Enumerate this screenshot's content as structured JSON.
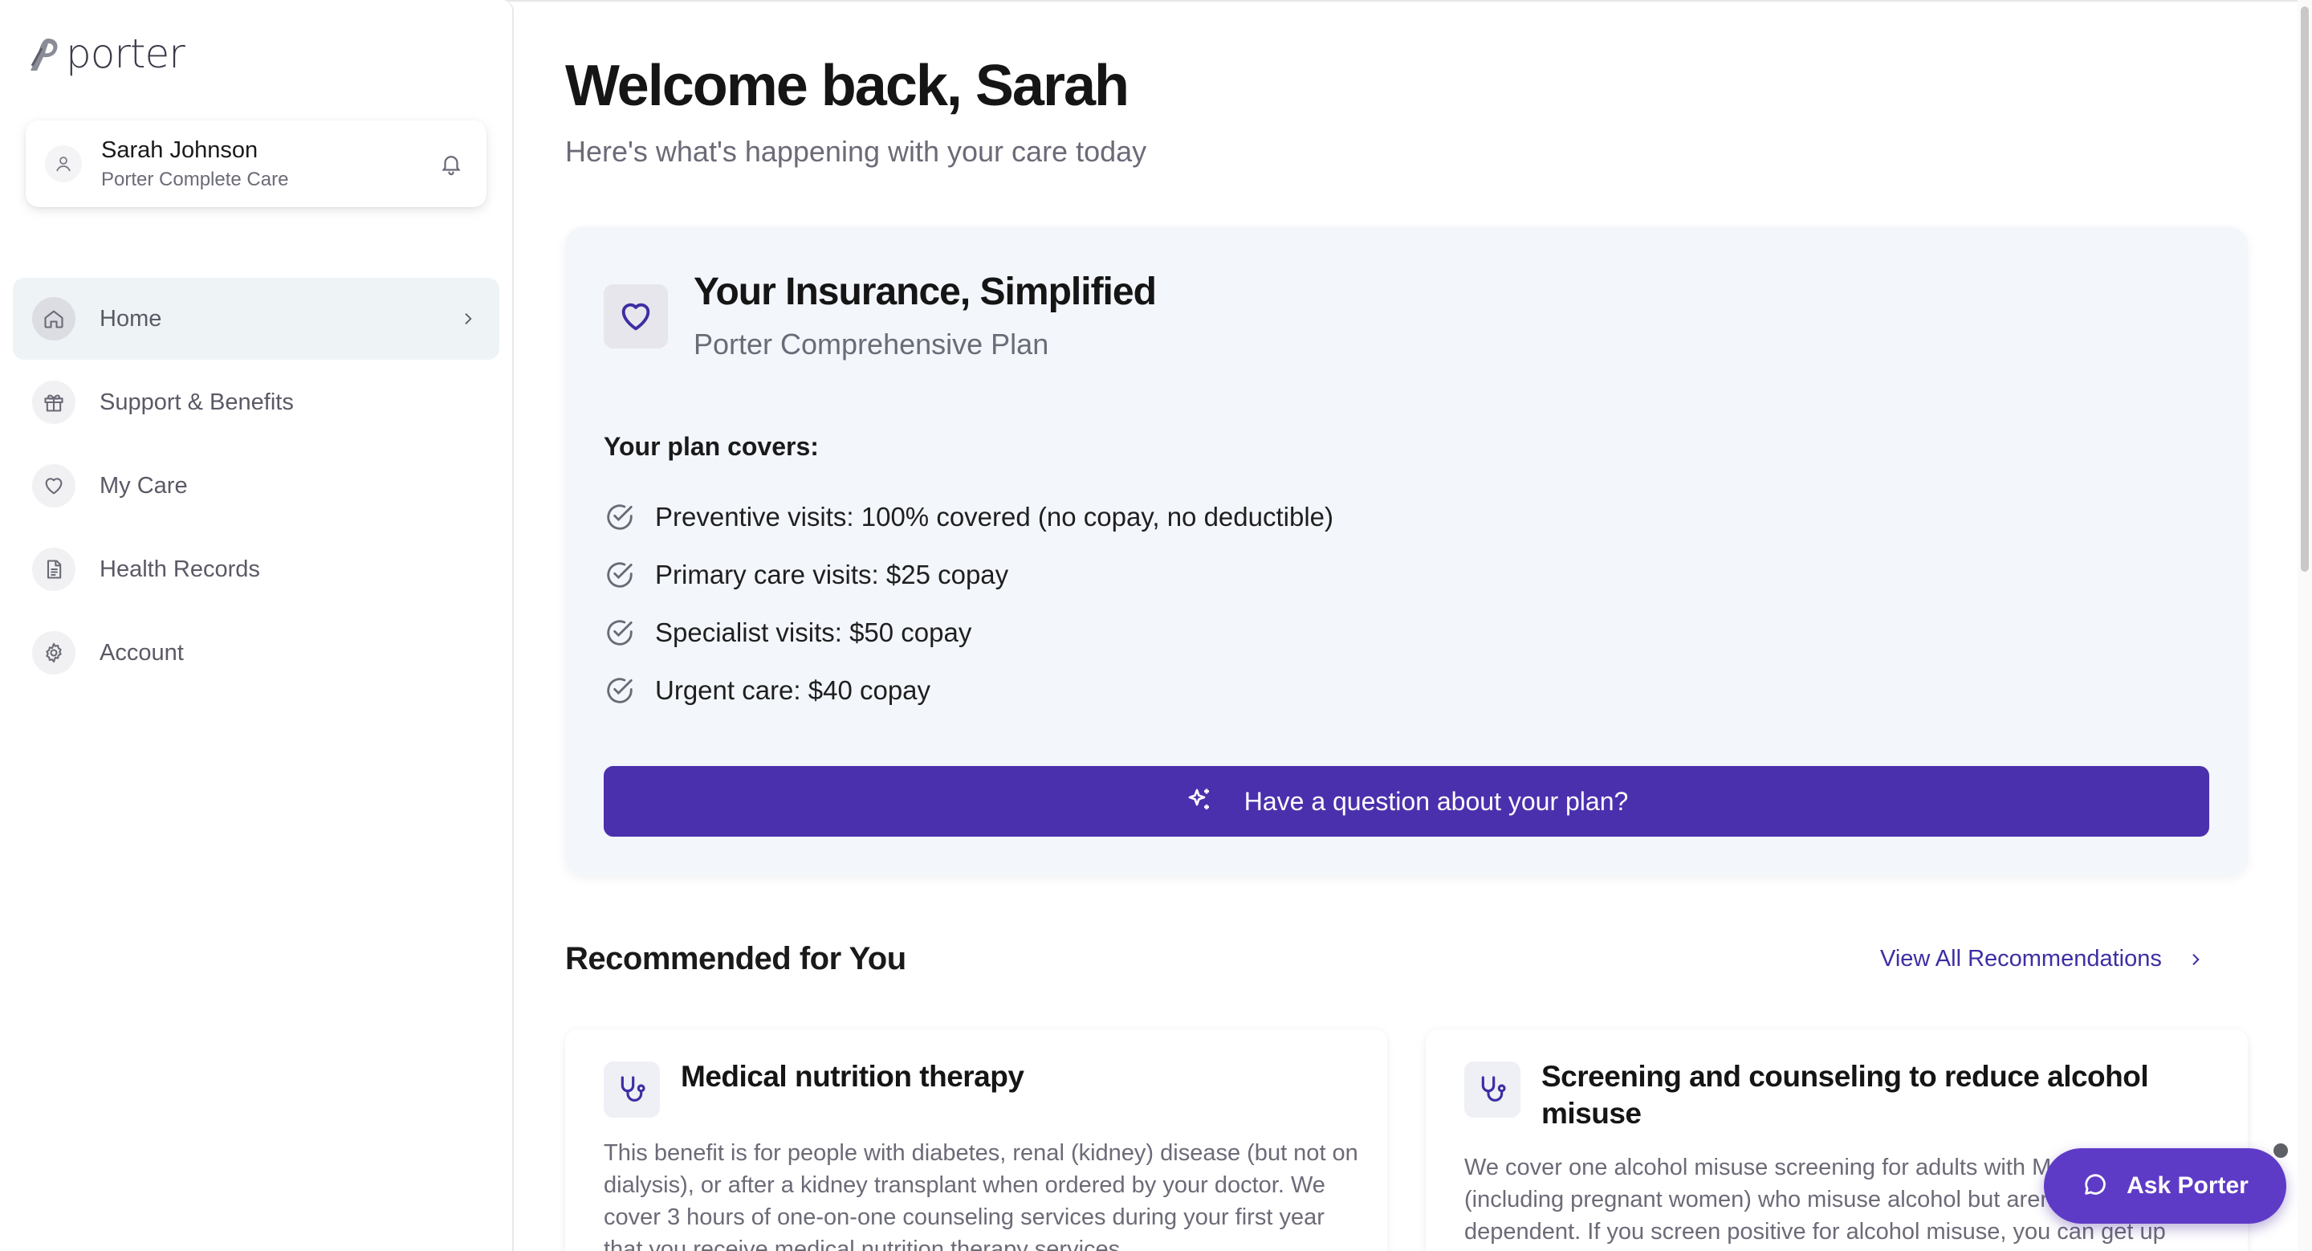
{
  "brand": {
    "logo_text": "porter",
    "accent": "#4b30ad"
  },
  "user": {
    "name": "Sarah Johnson",
    "plan": "Porter Complete Care"
  },
  "sidebar": {
    "items": [
      {
        "label": "Home",
        "icon": "home-icon",
        "active": true
      },
      {
        "label": "Support & Benefits",
        "icon": "gift-icon"
      },
      {
        "label": "My Care",
        "icon": "heart-icon"
      },
      {
        "label": "Health Records",
        "icon": "document-icon"
      },
      {
        "label": "Account",
        "icon": "gear-icon"
      }
    ]
  },
  "header": {
    "welcome": "Welcome back, Sarah",
    "subtitle": "Here's what's happening with your care today"
  },
  "insurance": {
    "title": "Your Insurance, Simplified",
    "plan_name": "Porter Comprehensive Plan",
    "covers_label": "Your plan covers:",
    "covers": [
      "Preventive visits: 100% covered (no copay, no deductible)",
      "Primary care visits: $25 copay",
      "Specialist visits: $50 copay",
      "Urgent care: $40 copay"
    ],
    "question_button": "Have a question about your plan?"
  },
  "recommendations": {
    "title": "Recommended for You",
    "view_all": "View All Recommendations",
    "cards": [
      {
        "title": "Medical nutrition therapy",
        "icon": "stethoscope-icon",
        "description": "This benefit is for people with diabetes, renal (kidney) disease (but not on dialysis), or after a kidney transplant when ordered by your doctor. We cover 3 hours of one-on-one counseling services during your first year that you receive medical nutrition therapy services"
      },
      {
        "title": "Screening and counseling to reduce alcohol misuse",
        "icon": "stethoscope-icon",
        "description": "We cover one alcohol misuse screening for adults with Medicare (including pregnant women) who misuse alcohol but aren't alcohol dependent. If you screen positive for alcohol misuse, you can get up"
      }
    ]
  },
  "assistant": {
    "label": "Ask Porter",
    "icon": "chat-bubble-icon"
  }
}
